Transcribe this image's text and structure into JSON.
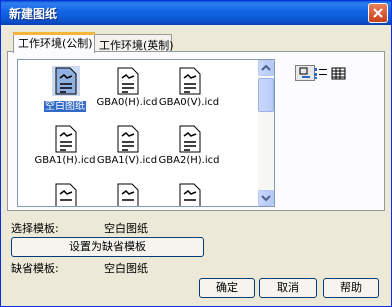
{
  "window": {
    "title": "新建图纸"
  },
  "tabs": [
    {
      "label": "工作环境(公制)"
    },
    {
      "label": "工作环境(英制)"
    }
  ],
  "templates": [
    {
      "label": "空白图纸",
      "selected": true,
      "icon": "blank-template-icon"
    },
    {
      "label": "GBA0(H).icd",
      "icon": "template-icon"
    },
    {
      "label": "GBA0(V).icd",
      "icon": "template-icon"
    },
    {
      "label": "GBA1(H).icd",
      "icon": "template-icon"
    },
    {
      "label": "GBA1(V).icd",
      "icon": "template-icon"
    },
    {
      "label": "GBA2(H).icd",
      "icon": "template-icon"
    },
    {
      "label": "",
      "icon": "template-icon"
    },
    {
      "label": "",
      "icon": "template-icon"
    },
    {
      "label": "",
      "icon": "template-icon"
    }
  ],
  "view_buttons": [
    "large-icons-view-icon",
    "list-view-icon",
    "details-view-icon"
  ],
  "selected_template": {
    "label": "选择模板:",
    "value": "空白图纸"
  },
  "set_default_button": "设置为缺省模板",
  "default_template": {
    "label": "缺省模板:",
    "value": "空白图纸"
  },
  "buttons": {
    "ok": "确定",
    "cancel": "取消",
    "help": "帮助"
  },
  "colors": {
    "titlebar": "#0a5bd6",
    "selection": "#316ac5",
    "tab_highlight": "#f7b539"
  }
}
